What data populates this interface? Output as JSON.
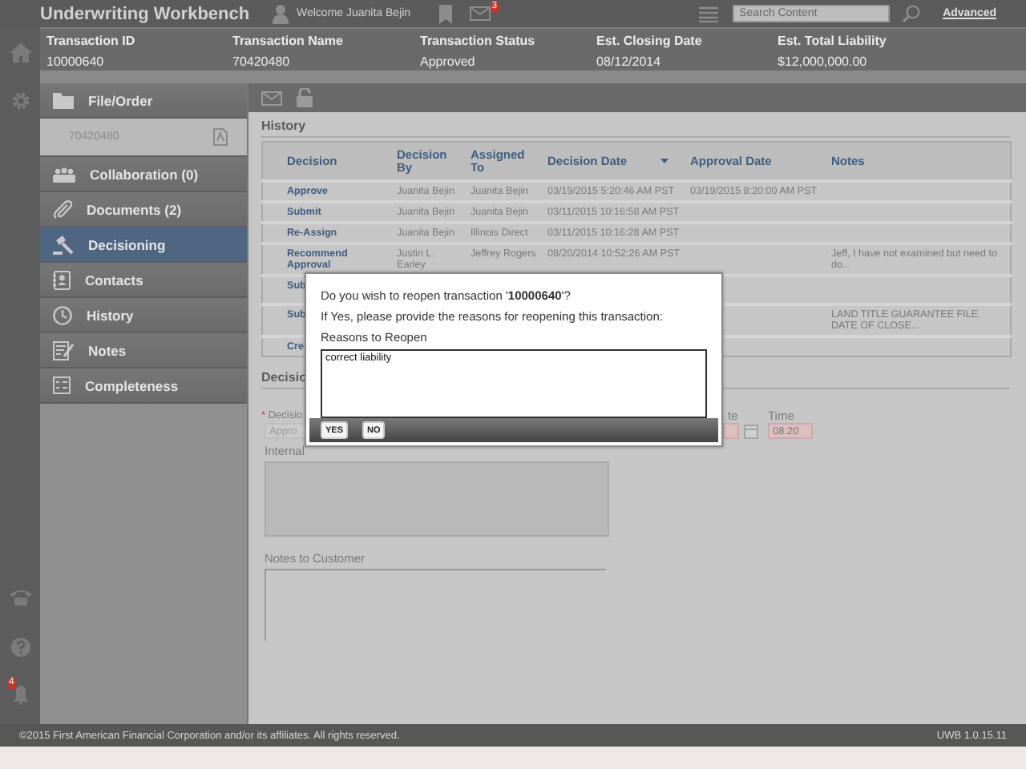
{
  "header": {
    "title": "Underwriting Workbench",
    "welcome": "Welcome Juanita Bejin",
    "mail_count": "3",
    "search": {
      "placeholder": "Search Content"
    },
    "advanced_link": "Advanced"
  },
  "transaction": {
    "fields": [
      {
        "label": "Transaction ID",
        "value": "10000640"
      },
      {
        "label": "Transaction Name",
        "value": "70420480"
      },
      {
        "label": "Transaction Status",
        "value": "Approved"
      },
      {
        "label": "Est. Closing Date",
        "value": "08/12/2014"
      },
      {
        "label": "Est. Total Liability",
        "value": "$12,000,000.00"
      }
    ]
  },
  "rail": {
    "alert_count": "4"
  },
  "sidebar": {
    "items": [
      {
        "label": "File/Order",
        "kind": "section",
        "selected": false
      },
      {
        "label": "70420480",
        "kind": "file",
        "selected": false
      },
      {
        "label": "Collaboration (0)",
        "kind": "section",
        "selected": false
      },
      {
        "label": "Documents (2)",
        "kind": "section",
        "selected": false
      },
      {
        "label": "Decisioning",
        "kind": "section",
        "selected": true
      },
      {
        "label": "Contacts",
        "kind": "section",
        "selected": false
      },
      {
        "label": "History",
        "kind": "section",
        "selected": false
      },
      {
        "label": "Notes",
        "kind": "section",
        "selected": false
      },
      {
        "label": "Completeness",
        "kind": "section",
        "selected": false
      }
    ]
  },
  "history": {
    "title": "History",
    "columns": [
      {
        "label": "Decision",
        "sorted": false
      },
      {
        "label": "Decision By",
        "sorted": false
      },
      {
        "label": "Assigned To",
        "sorted": false
      },
      {
        "label": "Decision Date",
        "sorted": true
      },
      {
        "label": "Approval Date",
        "sorted": false
      },
      {
        "label": "Notes",
        "sorted": false
      }
    ],
    "rows": [
      {
        "decision": "Approve",
        "decision_by": "Juanita Bejin",
        "assigned_to": "Juanita Bejin",
        "decision_date": "03/19/2015 5:20:46 AM PST",
        "approval_date": "03/19/2015 8:20:00 AM PST"
      },
      {
        "decision": "Submit",
        "decision_by": "Juanita Bejin",
        "assigned_to": "Juanita Bejin",
        "decision_date": "03/11/2015 10:16:58 AM PST"
      },
      {
        "decision": "Re-Assign",
        "decision_by": "Juanita Bejin",
        "assigned_to": "Illinois Direct",
        "decision_date": "03/11/2015 10:16:28 AM PST"
      },
      {
        "decision": "Recommend Approval",
        "decision_by": "Justin L. Earley",
        "assigned_to": "Jeffrey Rogers",
        "decision_date": "08/20/2014 10:52:26 AM PST",
        "notes": "Jeff, I have not examined but need to do..."
      },
      {
        "decision": "Sub"
      },
      {
        "decision": "Sub",
        "notes": "LAND TITLE GUARANTEE FILE. DATE OF CLOSE..."
      },
      {
        "decision": "Cre"
      }
    ]
  },
  "decision_form": {
    "title": "Decisio",
    "decision": {
      "required_mark": "*",
      "label": "Decisio",
      "value": "Appro"
    },
    "date": {
      "label": "te"
    },
    "time": {
      "label": "Time",
      "value": "08:20"
    },
    "internal_notes": {
      "label": "Internal"
    },
    "notes_to_customer": {
      "label": "Notes to Customer"
    }
  },
  "dialog": {
    "question": "Do you wish to reopen transaction '**10000640**'?",
    "instruction": "If Yes, please provide the reasons for reopening this transaction:",
    "field_label": "Reasons to Reopen",
    "reasons": {
      "value": "correct liability"
    },
    "buttons": [
      "YES",
      "NO"
    ]
  },
  "footer": {
    "copyright": "©2015 First American Financial Corporation and/or its affiliates. All rights reserved.",
    "version": "UWB 1.0.15.11"
  }
}
